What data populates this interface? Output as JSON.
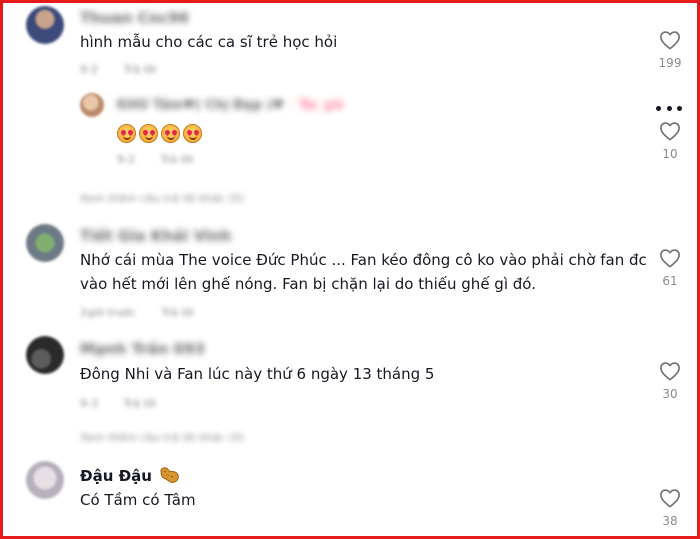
{
  "comments": [
    {
      "username": "Thuan Cnc96",
      "text": "hình mẫu cho các ca sĩ trẻ học hỏi",
      "date": "9-2",
      "reply_label": "Trả lời",
      "likes": "199"
    },
    {
      "username": "KHÚ Tâm♥( Chị Đẹp )♥",
      "author_tag": "· Tác giả",
      "date": "9-2",
      "reply_label": "Trả lời",
      "likes": "10",
      "emoji_count": 4
    },
    {
      "username": "Tiết Gia Khải Vinh",
      "text_lines": [
        "Nhớ cái mùa The voice Đức Phúc ... Fan kéo đông cô ko vào phải chờ fan đc",
        "vào hết mới lên ghế nóng. Fan bị chặn lại do thiếu ghế gì đó."
      ],
      "date": "2giờ trước",
      "reply_label": "Trả lời",
      "likes": "61"
    },
    {
      "username": "Mạnh Trần 093",
      "text": "Đông Nhi và Fan lúc này thứ 6 ngày 13 tháng 5",
      "date": "9-3",
      "reply_label": "Trả lời",
      "likes": "30"
    },
    {
      "username": "Đậu Đậu",
      "text": "Có Tầm có Tâm",
      "likes": "38"
    }
  ],
  "view_more": [
    "Xem thêm câu trả lời khác (5)",
    "Xem thêm câu trả lời khác (4)"
  ],
  "icons": {
    "like": "heart-outline-icon",
    "more": "more-dots-icon",
    "peanut": "peanut-icon"
  },
  "colors": {
    "frame": "#e51a1a",
    "author_tag": "#fe2c55",
    "muted": "#8a8b91"
  }
}
